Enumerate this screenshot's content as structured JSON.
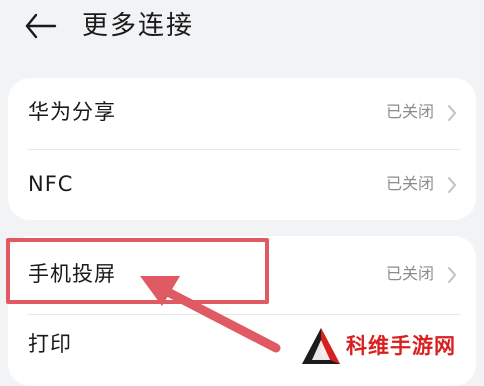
{
  "header": {
    "back_icon": "back-arrow-icon",
    "title": "更多连接"
  },
  "card1": {
    "items": [
      {
        "label": "华为分享",
        "status": "已关闭",
        "icon": "chevron-right-icon"
      },
      {
        "label": "NFC",
        "status": "已关闭",
        "icon": "chevron-right-icon"
      }
    ]
  },
  "card2": {
    "items": [
      {
        "label": "手机投屏",
        "status": "已关闭",
        "icon": "chevron-right-icon"
      },
      {
        "label": "打印"
      }
    ]
  },
  "annotation": {
    "highlight_color": "#e05a63",
    "arrow_color": "#e05a63"
  },
  "watermark": {
    "text": "科维手游网",
    "color": "#d92020"
  }
}
